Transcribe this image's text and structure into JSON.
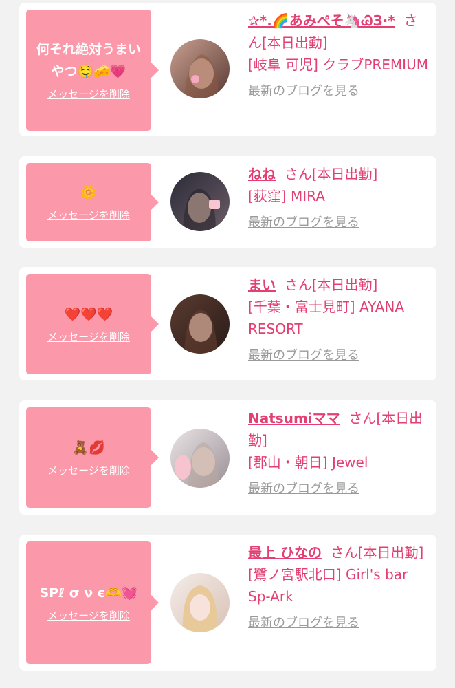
{
  "delete_label": "メッセージを削除",
  "blog_label": "最新のブログを見る",
  "colors": {
    "accent": "#e33f72",
    "bubble": "#fb98a9",
    "link_gray": "#9a9a9a",
    "background": "#f2f2f3"
  },
  "cards": [
    {
      "message": "何それ絶対うまいやつ🤤🧀💗",
      "name": "✰*.🌈あみぺそ🦄ᏊЗ·*",
      "suffix": "さん[本日出勤]",
      "shop": "[岐阜 可児] クラブPREMIUM"
    },
    {
      "message": "🌼",
      "name": "ねね",
      "suffix": "さん[本日出勤]",
      "shop": "[荻窪] MIRA"
    },
    {
      "message": "❤️❤️❤️",
      "name": "まい",
      "suffix": "さん[本日出勤]",
      "shop": "[千葉・富士見町] AYANA RESORT"
    },
    {
      "message": "🧸💋",
      "name": "Natsumiママ",
      "suffix": "さん[本日出勤]",
      "shop": "[郡山・朝日] Jewel"
    },
    {
      "message": "SPℓ σ ν є🫶💓",
      "name": "最上 ひなの",
      "suffix": "さん[本日出勤]",
      "shop": "[鷺ノ宮駅北口] Girl's bar Sp-Ark"
    }
  ]
}
